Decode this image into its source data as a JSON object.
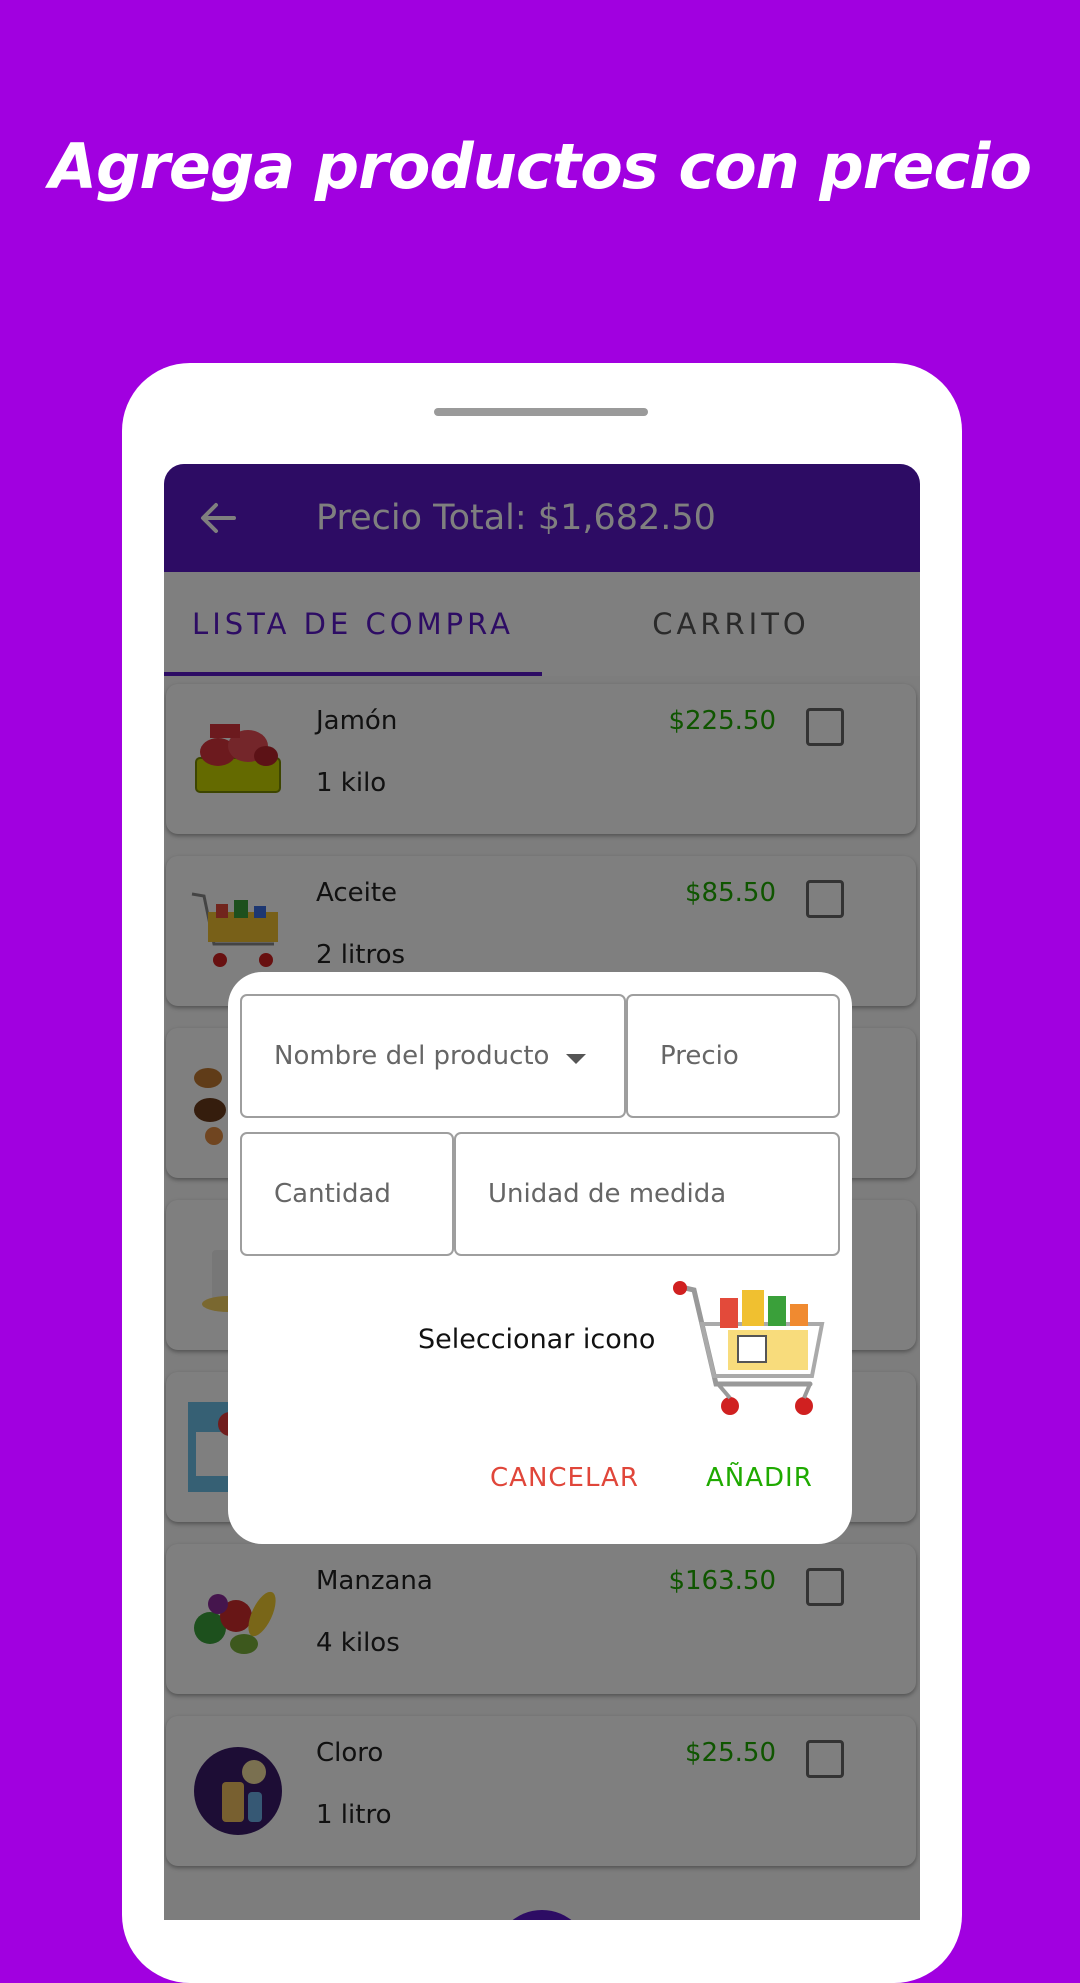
{
  "headline": "Agrega productos con precio",
  "appbar": {
    "title": "Precio Total: $1,682.50",
    "back_icon": "arrow-back-icon"
  },
  "tabs": [
    {
      "label": "LISTA DE COMPRA",
      "active": true
    },
    {
      "label": "CARRITO",
      "active": false
    }
  ],
  "products": [
    {
      "name": "Jamón",
      "quantity": "1 kilo",
      "price": "$225.50",
      "icon": "meat-basket-icon"
    },
    {
      "name": "Aceite",
      "quantity": "2 litros",
      "price": "$85.50",
      "icon": "shopping-cart-icon"
    },
    {
      "name": "",
      "quantity": "",
      "price": "",
      "icon": "bakery-icon"
    },
    {
      "name": "",
      "quantity": "",
      "price": "",
      "icon": "dairy-icon"
    },
    {
      "name": "",
      "quantity": "",
      "price": "",
      "icon": "receipt-icon"
    },
    {
      "name": "Manzana",
      "quantity": "4 kilos",
      "price": "$163.50",
      "icon": "fruits-icon"
    },
    {
      "name": "Cloro",
      "quantity": "1 litro",
      "price": "$25.50",
      "icon": "cleaning-icon"
    }
  ],
  "dialog": {
    "product_name_placeholder": "Nombre del producto",
    "price_placeholder": "Precio",
    "quantity_placeholder": "Cantidad",
    "unit_placeholder": "Unidad de medida",
    "select_icon_label": "Seleccionar icono",
    "cancel_label": "CANCELAR",
    "add_label": "AÑADIR",
    "selected_icon": "shopping-cart-icon"
  },
  "colors": {
    "background": "#a100e0",
    "primary": "#5b18c8",
    "price_green": "#1faa00",
    "cancel_red": "#e0463a"
  }
}
